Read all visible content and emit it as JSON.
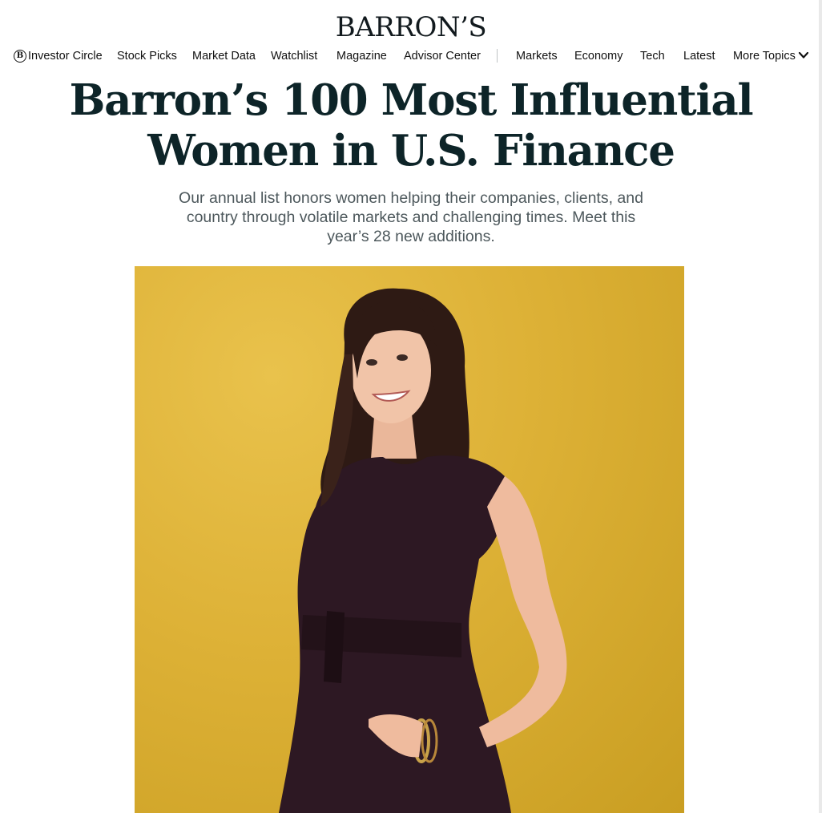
{
  "masthead": {
    "logo_text": "BARRON’S"
  },
  "nav": {
    "items": [
      {
        "label": "Investor Circle",
        "icon": "barrons-b-circle-icon"
      },
      {
        "label": "Stock Picks"
      },
      {
        "label": "Market Data"
      },
      {
        "label": "Watchlist"
      },
      {
        "label": "Magazine"
      },
      {
        "label": "Advisor Center"
      },
      {
        "label": "Markets"
      },
      {
        "label": "Economy"
      },
      {
        "label": "Tech"
      },
      {
        "label": "Latest"
      },
      {
        "label": "More Topics",
        "icon": "chevron-down-icon"
      }
    ]
  },
  "article": {
    "headline_line1": "Barron’s 100 Most Influential",
    "headline_line2": "Women in U.S. Finance",
    "dek_line1": "Our annual list honors women helping their companies, clients, and",
    "dek_line2": "country through volatile markets and challenging times. Meet this",
    "dek_line3": "year’s 28 new additions.",
    "hero_background_color": "#dbb136"
  }
}
